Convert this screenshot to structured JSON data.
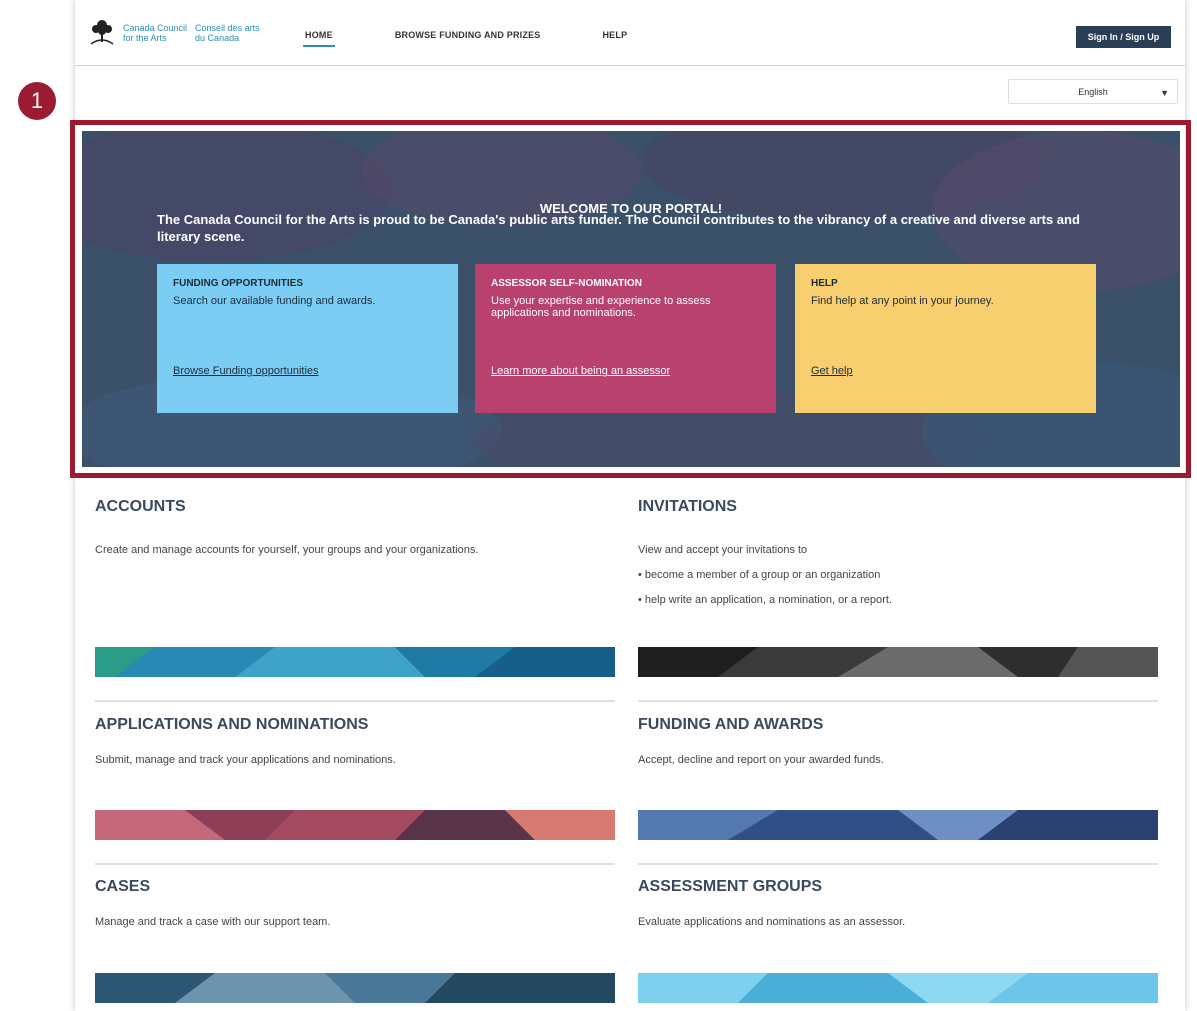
{
  "header": {
    "logo_en_line1": "Canada Council",
    "logo_en_line2": "for the Arts",
    "logo_fr_line1": "Conseil des arts",
    "logo_fr_line2": "du Canada",
    "nav": [
      "HOME",
      "BROWSE FUNDING AND PRIZES",
      "HELP"
    ],
    "signin_label": "Sign In / Sign Up"
  },
  "language": {
    "selected": "English"
  },
  "marker": {
    "number": "1"
  },
  "hero": {
    "title": "WELCOME TO OUR PORTAL!",
    "subtitle": "The Canada Council for the Arts is proud to be Canada's public arts funder. The Council contributes to the vibrancy of a creative and diverse arts and literary scene.",
    "cards": [
      {
        "title": "FUNDING OPPORTUNITIES",
        "text": "Search our available funding and awards.",
        "link": "Browse Funding opportunities"
      },
      {
        "title": "ASSESSOR SELF-NOMINATION",
        "text": "Use your expertise and experience to assess applications and nominations.",
        "link": "Learn more about being an assessor"
      },
      {
        "title": "HELP",
        "text": "Find help at any point in your journey.",
        "link": "Get help"
      }
    ]
  },
  "sections": {
    "accounts": {
      "title": "ACCOUNTS",
      "desc": " Create and manage accounts for yourself, your groups and your organizations."
    },
    "invitations": {
      "title": "INVITATIONS",
      "desc": "View and accept your invitations to",
      "bullets": [
        "• become a member of a group or an organization",
        "• help write an application, a nomination, or a report."
      ]
    },
    "applications": {
      "title": "APPLICATIONS AND NOMINATIONS",
      "desc": "Submit, manage and track your applications and nominations."
    },
    "funding": {
      "title": "FUNDING AND AWARDS",
      "desc": "Accept, decline and report on your awarded funds."
    },
    "cases": {
      "title": "CASES",
      "desc": "Manage and track a case with our support team."
    },
    "assessment": {
      "title": "ASSESSMENT GROUPS",
      "desc": "Evaluate applications and nominations as an assessor."
    }
  },
  "colors": {
    "brand_blue": "#2a8fb3",
    "signin_bg": "#2a3f55",
    "highlight": "#9b1b30",
    "card_blue": "#7ccdf4",
    "card_magenta": "#b9416d",
    "card_yellow": "#f8cf6e"
  }
}
